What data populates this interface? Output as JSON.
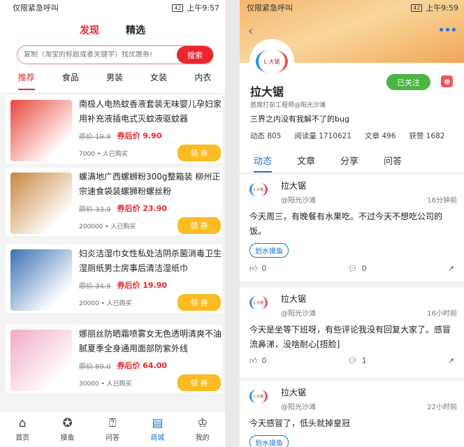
{
  "left": {
    "status": {
      "carrier": "仅限紧急呼叫",
      "battery": "42",
      "time": "上午9:57"
    },
    "top_tabs": [
      "发现",
      "精选"
    ],
    "search": {
      "placeholder": "复制（淘宝的标题或者关键字）找优惠券!",
      "button": "搜索"
    },
    "categories": [
      "推荐",
      "食品",
      "男装",
      "女装",
      "内衣"
    ],
    "products": [
      {
        "title": "南极人电热蚊香液套装无味婴儿孕妇家用补充液插电式灭蚊液驱蚊器",
        "orig": "原价 19.9",
        "after": "券后价 9.90",
        "sales": "7000 • 人已购买",
        "btn": "领 券",
        "color": "#e9463d"
      },
      {
        "title": "螺满地广西螺蛳粉300g整箱装 柳州正宗速食袋装螺狮粉螺丝粉",
        "orig": "原价 33.9",
        "after": "券后价 23.90",
        "sales": "200000 • 人已购买",
        "btn": "领 券",
        "color": "#c9853f"
      },
      {
        "title": "妇炎洁湿巾女性私处洁阴杀菌消毒卫生湿厕纸男士房事后清洁湿纸巾",
        "orig": "原价 34.9",
        "after": "券后价 19.90",
        "sales": "20000 • 人已购买",
        "btn": "领 券",
        "color": "#3a6fb3"
      },
      {
        "title": "娜丽丝防晒霜喷雾女无色透明清爽不油腻夏季全身通用面部防紫外线",
        "orig": "原价 89.0",
        "after": "券后价 64.00",
        "sales": "30000 • 人已购买",
        "btn": "领 券",
        "color": "#f1a9c6"
      }
    ],
    "nav": [
      {
        "label": "首页",
        "icon": "⌂"
      },
      {
        "label": "摸鱼",
        "icon": "✪"
      },
      {
        "label": "问答",
        "icon": "⍰"
      },
      {
        "label": "商城",
        "icon": "▤"
      },
      {
        "label": "我的",
        "icon": "♔"
      }
    ]
  },
  "right": {
    "status": {
      "carrier": "仅限紧急呼叫",
      "battery": "42",
      "time": "上午9:59"
    },
    "logo_text": "L·大锯",
    "name": "拉大锯",
    "follow": "已关注",
    "subtitle": "首席打杂工程师@阳光沙滩",
    "bio": "三界之内没有我解不了的bug",
    "stats": [
      "动态 805",
      "阅读量 1710621",
      "文章 496",
      "获赞 1682"
    ],
    "tabs": [
      "动态",
      "文章",
      "分享",
      "问答"
    ],
    "posts": [
      {
        "name": "拉大锯",
        "handle": "@阳光沙滩",
        "time": "16分钟前",
        "content": "今天周三，有晚餐有水果吃。不过今天不想吃公司的饭。",
        "tag": "划水摸鱼",
        "likes": "0",
        "comments": "0"
      },
      {
        "name": "拉大锯",
        "handle": "@阳光沙滩",
        "time": "16小时前",
        "content": "今天是坐等下班呀，有些评论我没有回复大家了。感冒流鼻涕，没啥耐心[捂脸]",
        "likes": "0",
        "comments": "1"
      },
      {
        "name": "拉大锯",
        "handle": "@阳光沙滩",
        "time": "22小时前",
        "content": "今天感冒了，低头就掉皇冠",
        "tag": "划水摸鱼"
      }
    ]
  }
}
